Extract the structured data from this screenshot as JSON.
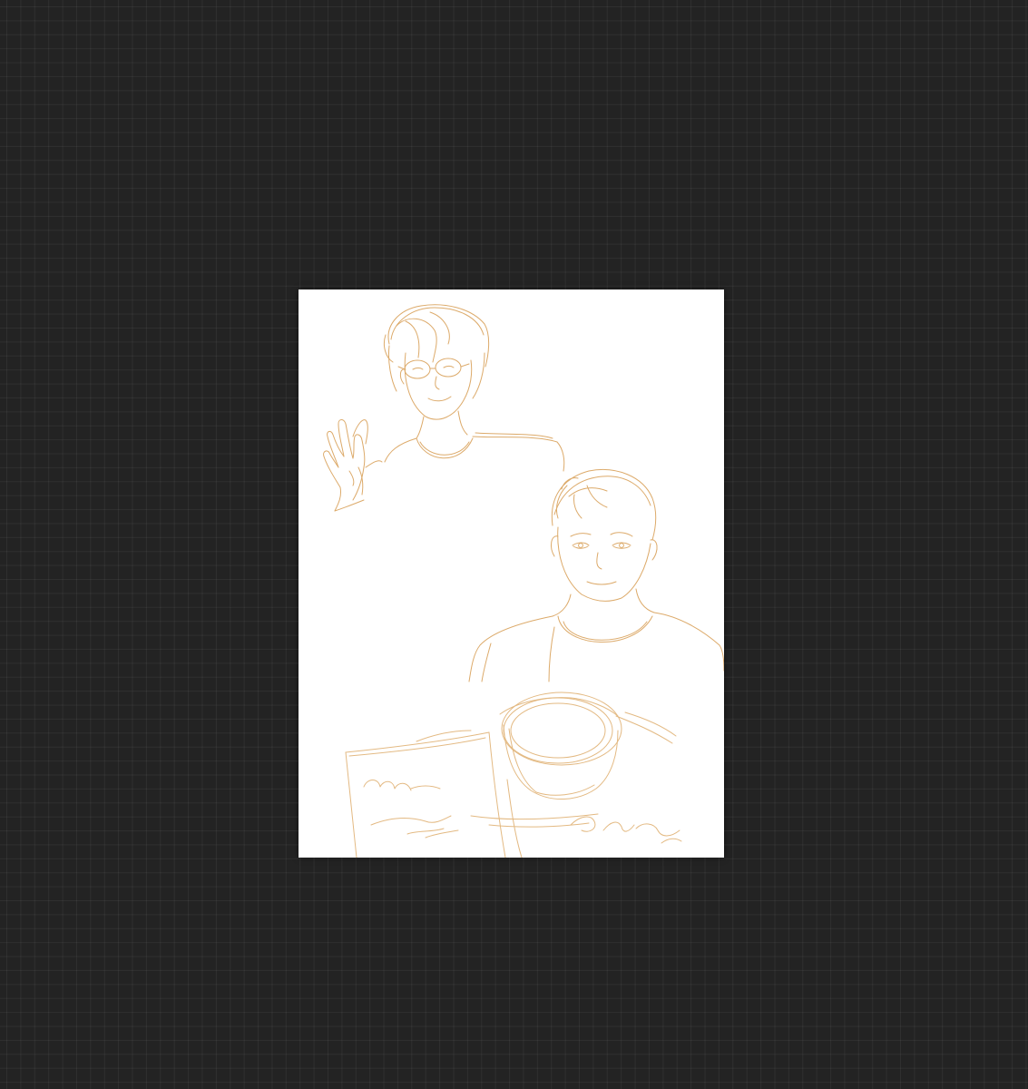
{
  "app": {
    "workspace": "drawing-canvas",
    "background_color": "#232323",
    "grid_color": "#2e2e2e"
  },
  "canvas": {
    "paper_color": "#ffffff",
    "sketch_color": "#d9a15a",
    "sketch_color_light": "#e8c08c"
  },
  "artwork": {
    "signature": "C.ry"
  }
}
